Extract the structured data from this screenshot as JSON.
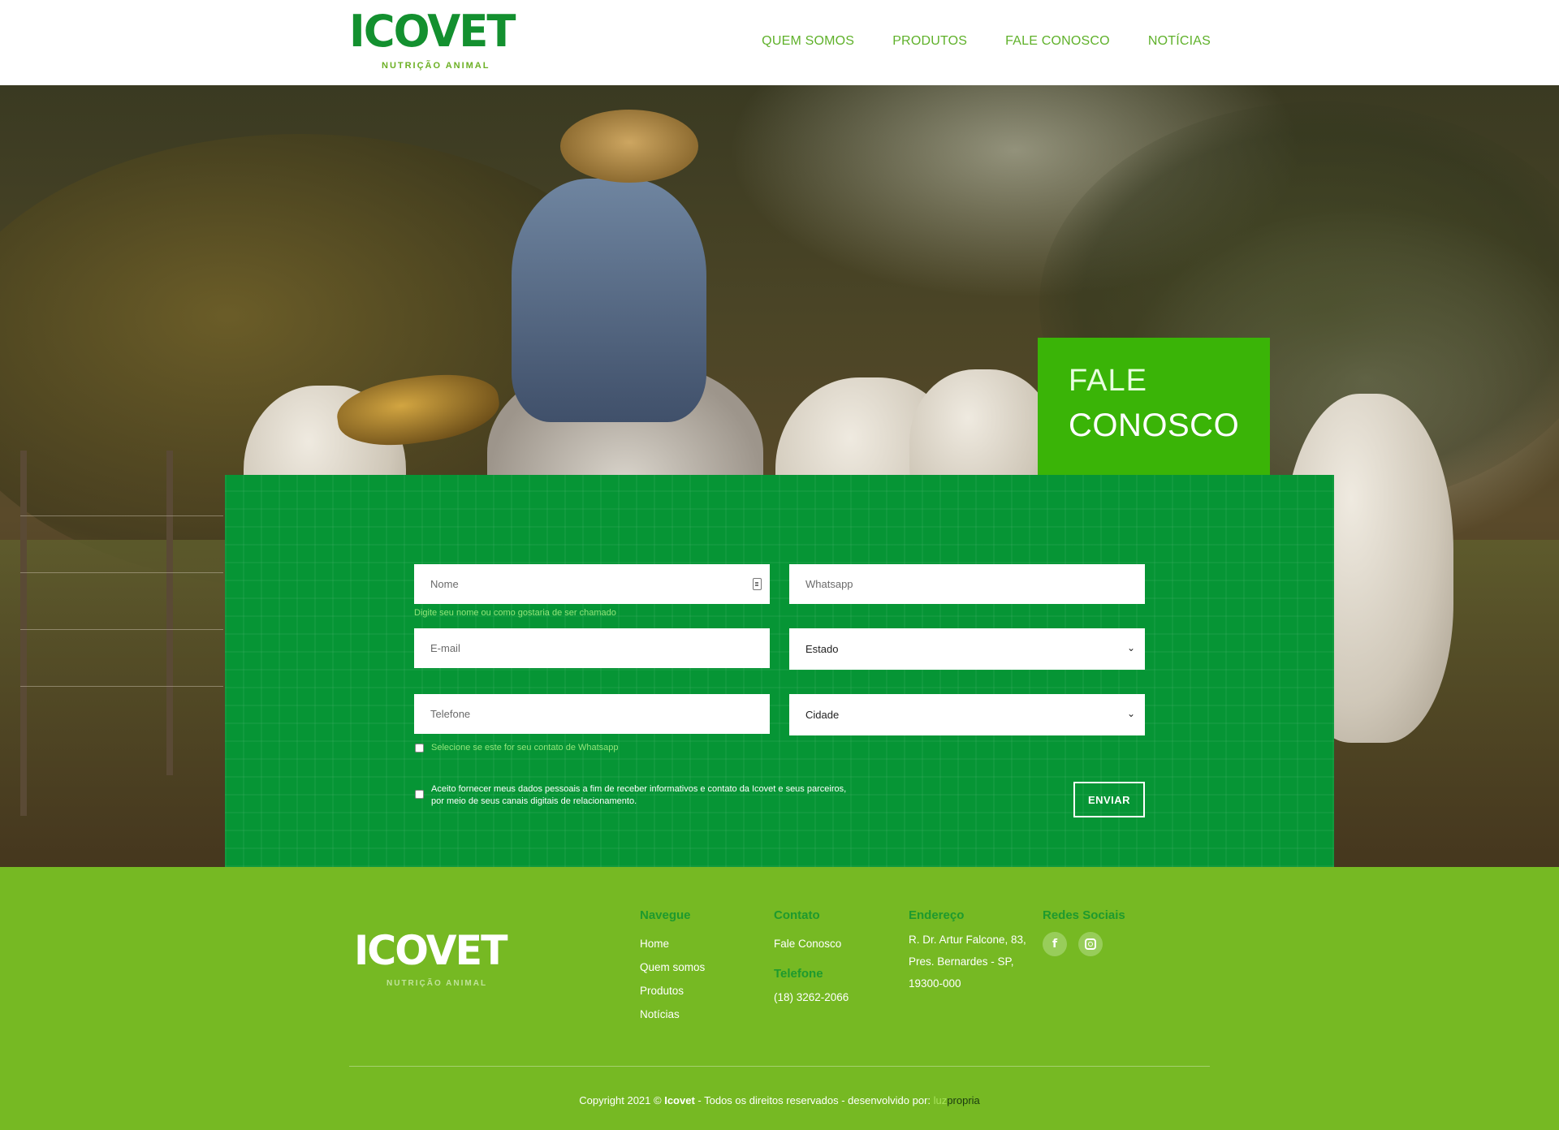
{
  "header": {
    "logo_text": "ICOVET",
    "logo_subtitle": "NUTRIÇÃO ANIMAL",
    "nav": [
      {
        "label": "QUEM SOMOS"
      },
      {
        "label": "PRODUTOS"
      },
      {
        "label": "FALE CONOSCO"
      },
      {
        "label": "NOTÍCIAS"
      }
    ]
  },
  "hero": {
    "tab_line1": "FALE",
    "tab_line2": "CONOSCO"
  },
  "form": {
    "nome_placeholder": "Nome",
    "nome_hint": "Digite seu nome ou como gostaria de ser chamado",
    "whatsapp_placeholder": "Whatsapp",
    "email_placeholder": "E-mail",
    "estado_selected": "Estado",
    "telefone_placeholder": "Telefone",
    "cidade_selected": "Cidade",
    "whatsapp_checkbox_label": "Selecione se este for seu contato de Whatsapp",
    "consent_label": "Aceito fornecer meus dados pessoais a fim de receber informativos e contato da Icovet e seus parceiros, por meio de seus canais digitais de relacionamento.",
    "submit_label": "ENVIAR"
  },
  "footer": {
    "logo_text": "ICOVET",
    "logo_subtitle": "NUTRIÇÃO ANIMAL",
    "navegue": {
      "heading": "Navegue",
      "links": [
        "Home",
        "Quem somos",
        "Produtos",
        "Notícias"
      ]
    },
    "contato": {
      "heading": "Contato",
      "link": "Fale Conosco",
      "telefone_heading": "Telefone",
      "telefone": "(18) 3262-2066"
    },
    "endereco": {
      "heading": "Endereço",
      "lines": [
        "R. Dr. Artur Falcone, 83,",
        "Pres. Bernardes - SP,",
        "19300-000"
      ]
    },
    "redes": {
      "heading": "Redes Sociais",
      "icons": [
        "facebook-icon",
        "instagram-icon"
      ]
    },
    "copyright_prefix": "Copyright 2021 ©",
    "copyright_brand": "Icovet",
    "copyright_suffix": "- Todos os direitos reservados - desenvolvido por:",
    "dev_part1": "luz",
    "dev_part2": "propria"
  },
  "colors": {
    "brand_green": "#13902f",
    "nav_green": "#5fb12a",
    "form_panel": "#069535",
    "tab_green": "#3ab407",
    "footer_green": "#76b923"
  }
}
